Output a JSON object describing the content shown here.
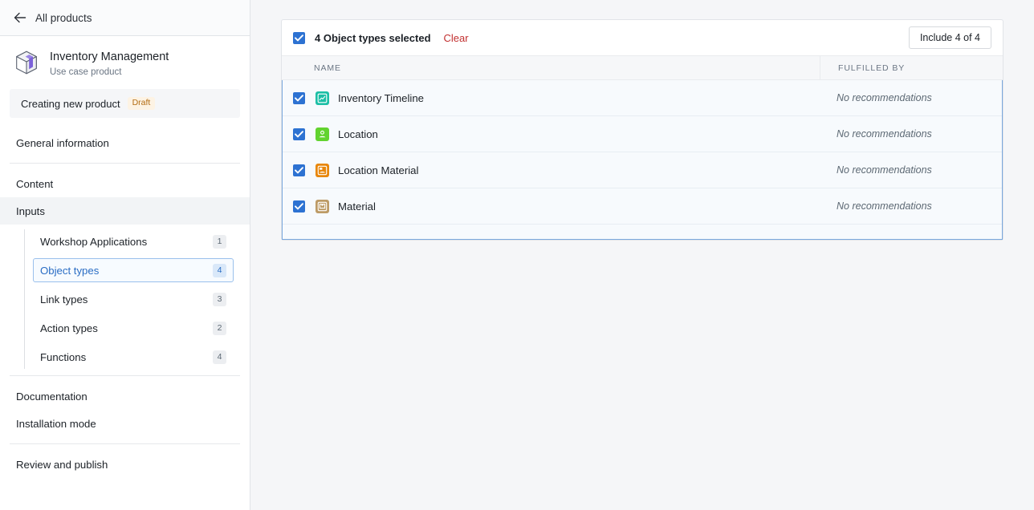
{
  "sidebar": {
    "back": {
      "label": "All products",
      "icon": "arrow-left-icon"
    },
    "product": {
      "title": "Inventory Management",
      "subtitle": "Use case product",
      "icon": "cube-product-icon"
    },
    "status": {
      "text": "Creating new product",
      "badge": "Draft"
    },
    "nav": [
      {
        "label": "General information",
        "active": false
      },
      {
        "label": "Content",
        "active": false
      },
      {
        "label": "Inputs",
        "active": true
      }
    ],
    "sub_items": [
      {
        "label": "Workshop Applications",
        "count": "1",
        "selected": false
      },
      {
        "label": "Object types",
        "count": "4",
        "selected": true
      },
      {
        "label": "Link types",
        "count": "3",
        "selected": false
      },
      {
        "label": "Action types",
        "count": "2",
        "selected": false
      },
      {
        "label": "Functions",
        "count": "4",
        "selected": false
      }
    ],
    "nav_lower": [
      {
        "label": "Documentation"
      },
      {
        "label": "Installation mode"
      }
    ],
    "nav_final": [
      {
        "label": "Review and publish"
      }
    ]
  },
  "main": {
    "selection": {
      "title": "4 Object types selected",
      "clear_label": "Clear",
      "include_label": "Include 4 of 4",
      "checked": true
    },
    "columns": {
      "name": "NAME",
      "fulfilled_by": "FULFILLED BY"
    },
    "rows": [
      {
        "name": "Inventory Timeline",
        "fulfilled_by": "No recommendations",
        "icon": "timeline-chart-icon",
        "icon_color": "#1dbfa6",
        "checked": true
      },
      {
        "name": "Location",
        "fulfilled_by": "No recommendations",
        "icon": "location-pin-icon",
        "icon_color": "#62d32f",
        "checked": true
      },
      {
        "name": "Location Material",
        "fulfilled_by": "No recommendations",
        "icon": "location-material-icon",
        "icon_color": "#e8870b",
        "checked": true
      },
      {
        "name": "Material",
        "fulfilled_by": "No recommendations",
        "icon": "material-box-icon",
        "icon_color": "#bd9b66",
        "checked": true
      }
    ]
  },
  "colors": {
    "accent_blue": "#2d72d2",
    "clear_red": "#c23030",
    "draft_amber": "#b26b12",
    "panel_border_blue": "#7aa8dd"
  }
}
